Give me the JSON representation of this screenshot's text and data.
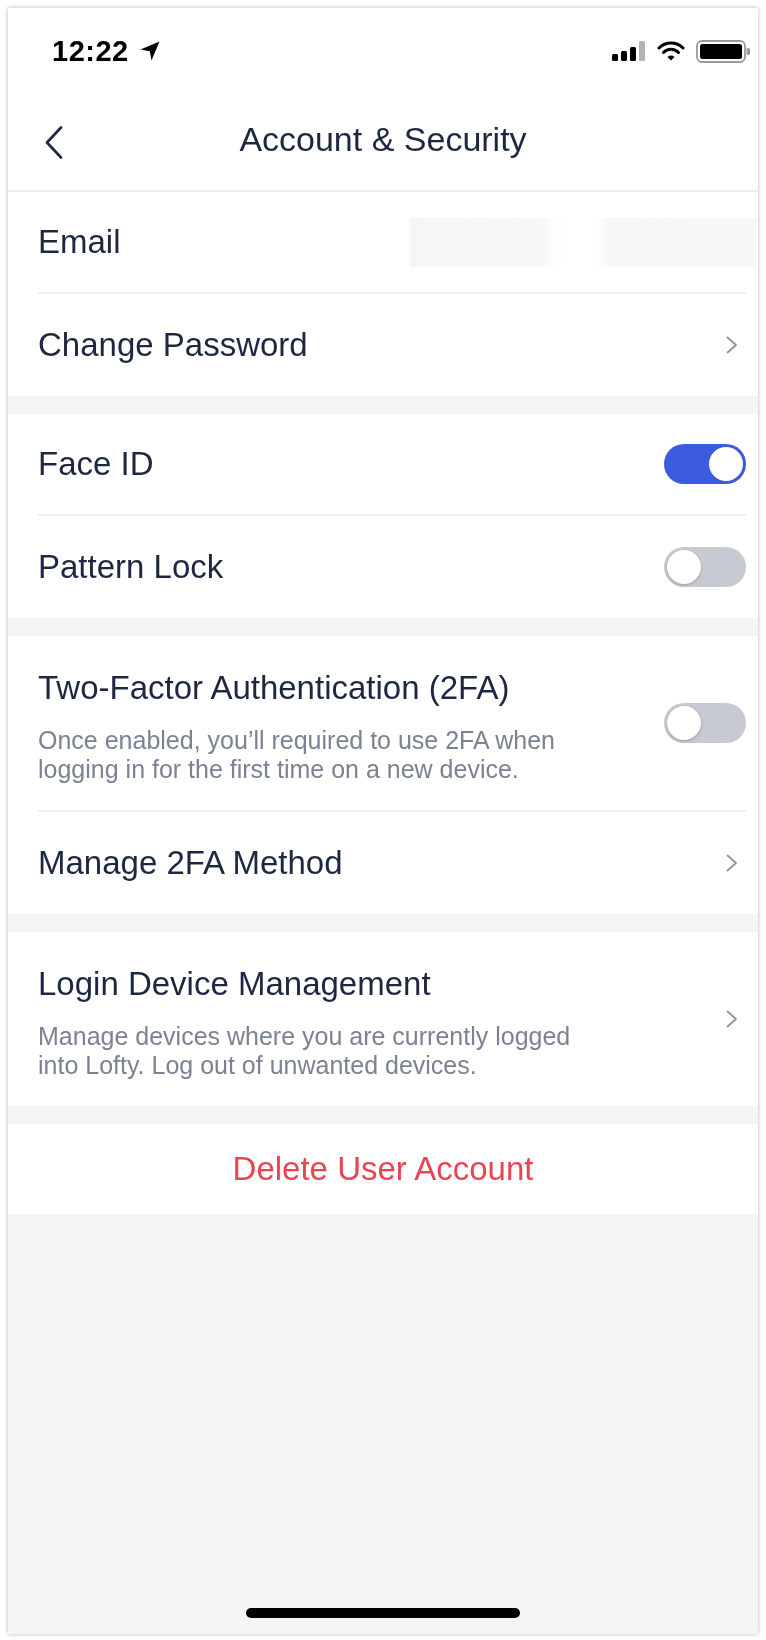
{
  "status_bar": {
    "time": "12:22"
  },
  "nav_bar": {
    "title": "Account & Security"
  },
  "sections": [
    {
      "rows": [
        {
          "kind": "redacted",
          "label": "Email"
        },
        {
          "kind": "link",
          "label": "Change Password"
        }
      ]
    },
    {
      "rows": [
        {
          "kind": "toggle",
          "label": "Face ID",
          "on": true
        },
        {
          "kind": "toggle",
          "label": "Pattern Lock",
          "on": false
        }
      ]
    },
    {
      "rows": [
        {
          "kind": "toggle",
          "label": "Two-Factor Authentication (2FA)",
          "description": "Once enabled, you’ll required to use 2FA when logging in for the first time on a new device.",
          "on": false
        },
        {
          "kind": "link",
          "label": "Manage 2FA Method"
        }
      ]
    },
    {
      "rows": [
        {
          "kind": "link",
          "label": "Login Device Management",
          "description": "Manage devices where you are currently logged into Lofty. Log out of unwanted devices."
        }
      ]
    },
    {
      "rows": [
        {
          "kind": "action",
          "label": "Delete User Account"
        }
      ]
    }
  ]
}
